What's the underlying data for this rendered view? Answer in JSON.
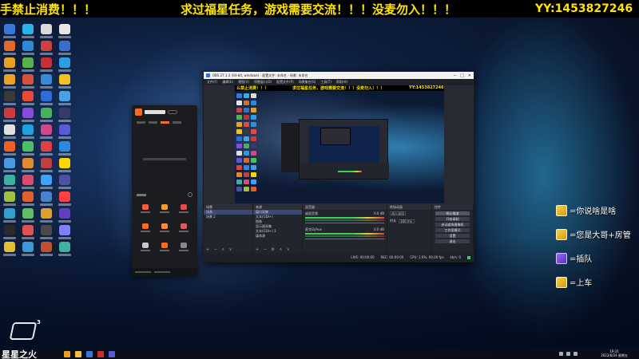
{
  "banner": {
    "part1": "手禁止消费！！！",
    "part2": "求过福星任务，游戏需要交流！！！没麦勿入！！！",
    "part3": "YY:1453827246"
  },
  "desktop_icon_colors": [
    "#3a78d6",
    "#2bb3e8",
    "#d9d9d9",
    "#e6e6e6",
    "#e06a2a",
    "#2c8ad6",
    "#d04040",
    "#3a6fc9",
    "#e8a020",
    "#5ab04a",
    "#c83030",
    "#2f9de0",
    "#f0a020",
    "#d9503a",
    "#3a8ad6",
    "#f5c020",
    "#3a3a3a",
    "#e84a3a",
    "#2c6ed6",
    "#4aa0e0",
    "#d03a3a",
    "#8a4ae0",
    "#4ab05a",
    "#3a3a6a",
    "#e0e0e0",
    "#20a0e0",
    "#d04a8a",
    "#5a5ad6",
    "#f06020",
    "#4ac060",
    "#e04040",
    "#2a8ae0",
    "#4a9ae0",
    "#e08a30",
    "#c04040",
    "#ffd700",
    "#3ab0a0",
    "#e04a6a",
    "#40a0ff",
    "#5050a0",
    "#a0c040",
    "#e06030",
    "#4a80d0",
    "#ff4040",
    "#30a0d0",
    "#60c060",
    "#e0a030",
    "#6040c0",
    "#2a2a2a",
    "#e05050",
    "#4a4a4a",
    "#8080ff",
    "#e0c030",
    "#3a9ad6",
    "#c05030",
    "#40b0a0"
  ],
  "obs": {
    "title": "OBS 27.1.3 (64-bit, windows) - 配置文件: 未命名 - 场景: 未命名",
    "window_controls": [
      "─",
      "□",
      "✕"
    ],
    "menu": [
      "文件(F)",
      "编辑(E)",
      "视图(V)",
      "停靠窗口(D)",
      "配置文件(P)",
      "场景集合(S)",
      "工具(T)",
      "帮助(H)"
    ],
    "preview_banner": [
      "么禁止消费！！！",
      "求过福星任务，游戏需要交流！！！没麦勿入！！！",
      "YY:1453827246"
    ],
    "scenes": {
      "title": "场景",
      "items": [
        "场景",
        "场景 2"
      ],
      "controls": "+ − ∧ ∨"
    },
    "sources": {
      "title": "来源",
      "items": [
        "窗口采集",
        "文本(GDI+)",
        "图像",
        "显示器采集",
        "文本(GDI+) 2",
        "媒体源"
      ],
      "controls": "+ − ⚙ ∧ ∨"
    },
    "mixer": {
      "title": "混音器",
      "tracks": [
        {
          "name": "桌面音频",
          "db": "0.0 dB"
        },
        {
          "name": "麦克风/Aux",
          "db": "0.0 dB"
        }
      ]
    },
    "transitions": {
      "title": "转场动画",
      "type": "淡入淡出",
      "duration_label": "时长",
      "duration": "300 ms"
    },
    "controls": {
      "title": "控件",
      "buttons": [
        "停止推流",
        "开始录制",
        "启动虚拟摄像机",
        "工作室模式",
        "设置",
        "退出"
      ]
    },
    "status": [
      "LIVE: 00:00:00",
      "REC: 00:00:00",
      "CPU: 2.6%, 60.00 fps",
      "kb/s: 0"
    ],
    "colors": {
      "panel": "#22252d",
      "header": "#2b2e38",
      "accent": "#3a4a73"
    }
  },
  "assistant": {
    "tab_count": 4,
    "grid_icon_colors": [
      "#ff5a3a",
      "#ff9a2a",
      "#e84a4a",
      "#ff6a1a",
      "#ff8a3a",
      "#e05a5a",
      "#c8c8c8",
      "#ff6a1a",
      "#888888"
    ],
    "accent": "#ff6a1a"
  },
  "chat": {
    "messages": [
      {
        "text": "=你说啥是啥",
        "avatar": "gold"
      },
      {
        "text": "=您是大哥+房管",
        "avatar": "gold"
      },
      {
        "text": "=插队",
        "avatar": "purple"
      },
      {
        "text": "=上车",
        "avatar": "gold"
      }
    ]
  },
  "overlay": {
    "logo_number": "3",
    "brand_text": "星星之火"
  },
  "taskbar": {
    "icon_colors": [
      "#e8a020",
      "#f0c040",
      "#3a78d6",
      "#c83030",
      "#5a5ad6"
    ],
    "clock_time": "19:31",
    "clock_date": "2022/6/24 星期五"
  }
}
